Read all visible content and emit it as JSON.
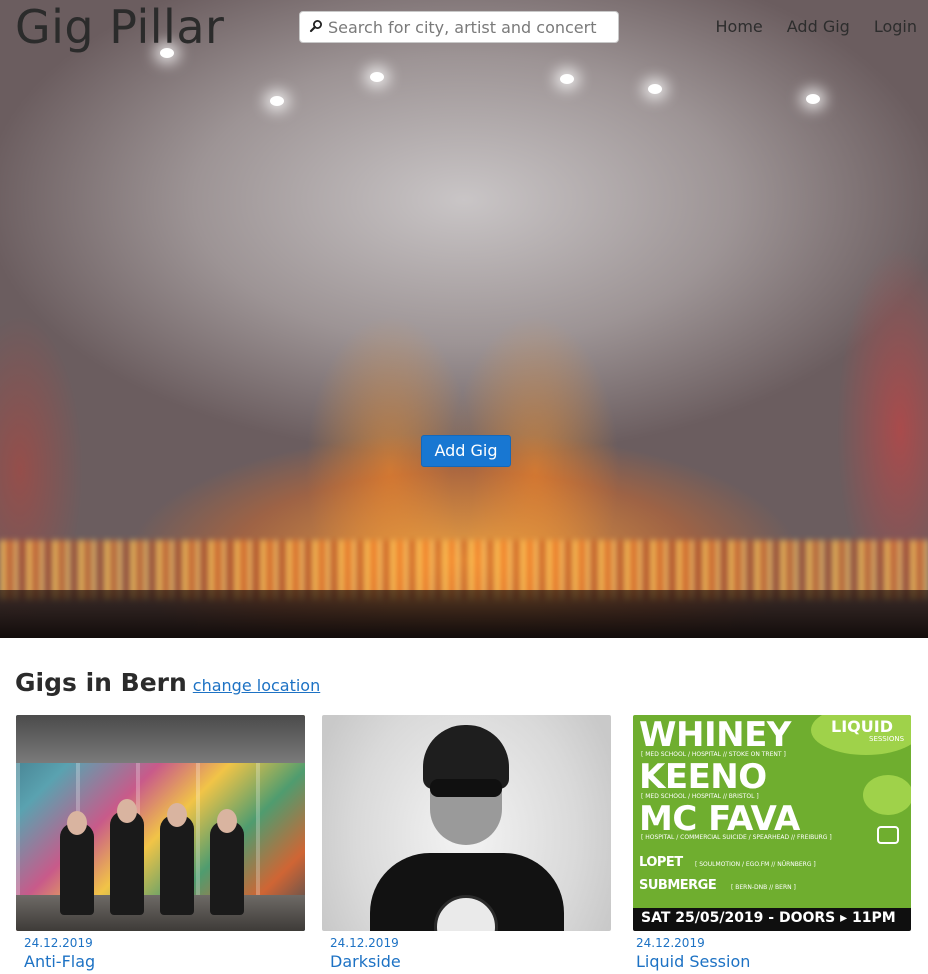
{
  "app": {
    "brand": "Gig Pillar"
  },
  "search": {
    "placeholder": "Search for city, artist and concert"
  },
  "nav": {
    "items": [
      "Home",
      "Add Gig",
      "Login"
    ]
  },
  "hero": {
    "cta_label": "Add Gig"
  },
  "section": {
    "title": "Gigs in Bern",
    "change_location_label": "change location"
  },
  "gigs": [
    {
      "date": "24.12.2019",
      "title": "Anti-Flag"
    },
    {
      "date": "24.12.2019",
      "title": "Darkside"
    },
    {
      "date": "24.12.2019",
      "title": "Liquid Session"
    }
  ],
  "flyer": {
    "logo": "LIQUID",
    "logo_sub": "SESSIONS",
    "lines": [
      "WHINEY",
      "KEENO",
      "MC FAVA"
    ],
    "sub_lines": [
      "[ MED SCHOOL / HOSPITAL // STOKE ON TRENT ]",
      "[ MED SCHOOL / HOSPITAL // BRISTOL ]",
      "[ HOSPITAL / COMMERCIAL SUICIDE / SPEARHEAD // FREIBURG ]"
    ],
    "lopet": "LOPET",
    "lopet_sub": "[ SOULMOTION / EGO.FM // NÜRNBERG ]",
    "submerge": "SUBMERGE",
    "submerge_sub": "[ BERN-DNB // BERN ]",
    "bottom": "SAT 25/05/2019 - DOORS ▸ 11PM"
  },
  "colors": {
    "primary": "#1877d2",
    "link": "#1d72c4",
    "text": "#2b2b2b"
  }
}
